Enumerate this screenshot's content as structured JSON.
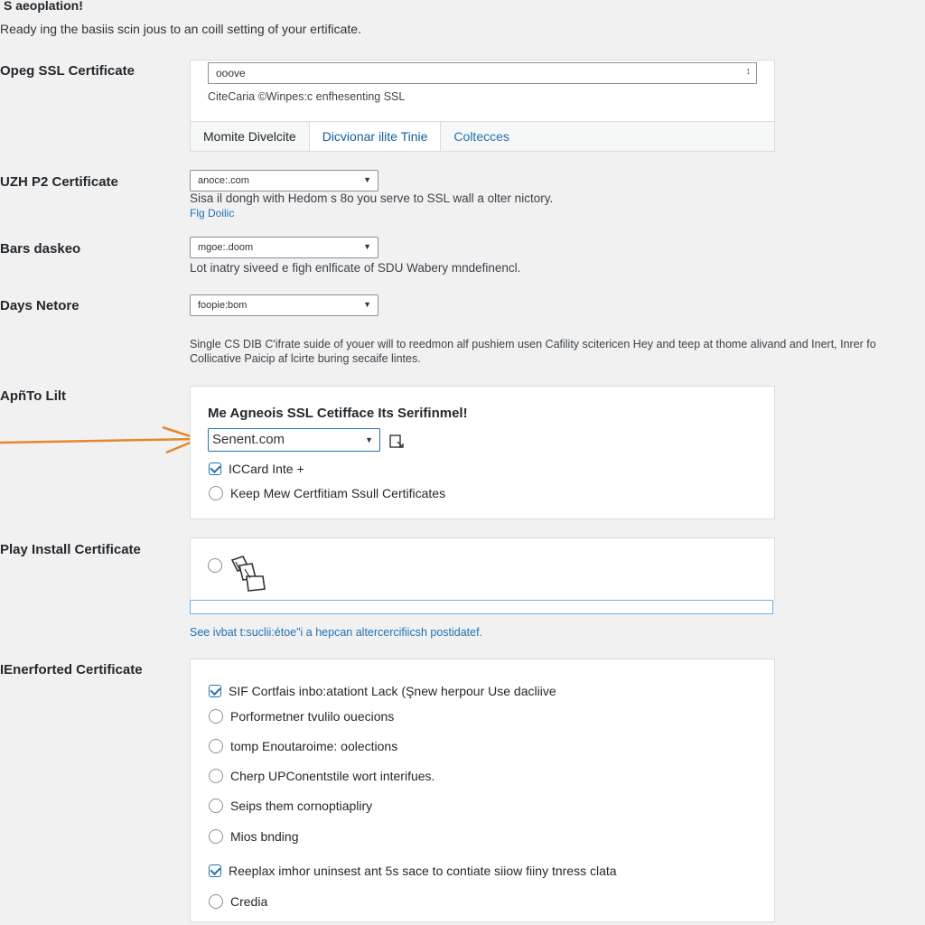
{
  "header": {
    "title": "S aeoplation!",
    "intro": "Ready ing the basiis scin jous to an coill setting of your ertificate."
  },
  "open_ssl": {
    "label": "Opeg SSL Certificate",
    "input_value": "ooove",
    "helper": "CiteCaria ©Winpes:c enfhesenting SSL",
    "tabs": [
      {
        "label": "Momite Divelcite",
        "active": false
      },
      {
        "label": "Dicvionar ilite Tinie",
        "active": true
      },
      {
        "label": "Coltecces",
        "active": false
      }
    ]
  },
  "uzr": {
    "label": "UZH P2 Certificate",
    "select_value": "anoce:.com",
    "desc": "Sisa il dongh with Hedom s 8o you serve to SSL wall a olter nictory.",
    "link": "Flg Doilic"
  },
  "bars": {
    "label": "Bars daskeo",
    "select_value": "mgoe:.doom",
    "desc": "Lot inatry siveed e figh enlficate of SDU Wabery mndefinencl."
  },
  "days": {
    "label": "Days Netore",
    "select_value": "foopie:bom",
    "desc_line1": "Single CS DIB C'ifrate suide of youer will to reedmon alf pushiem usen Cafility scitericen Hey and teep at thome alivand and Inert, Inrer fo",
    "desc_line2": "Collicative Paicip af lcirte buring secaife lintes."
  },
  "apply": {
    "label": "ApñTo Lilt",
    "heading": "Me Agneois SSL Cetifface Its Serifinmel!",
    "select_value": "Senent.com",
    "options": [
      {
        "label": "ICCard Inte +",
        "type": "checkbox",
        "checked": true
      },
      {
        "label": "Keep Mew Certfitiam Ssull Certificates",
        "type": "radio",
        "checked": false
      }
    ]
  },
  "install": {
    "label": "Play Install Certificate",
    "link": "See ivbat t:suclii:étoe\"i a hepcan altercercifiicsh postidatef."
  },
  "enforced": {
    "label": "IEnerforted Certificate",
    "options": [
      {
        "label": "SIF Cortfais inbo:atationt Lack (Şnew herpour Use dacliive",
        "type": "checkbox",
        "checked": true
      },
      {
        "label": "Porformetner tvulilo ouecions",
        "type": "radio",
        "checked": false
      },
      {
        "label": "tomp Enoutaroime: oolections",
        "type": "radio",
        "checked": false
      },
      {
        "label": "Cherp UPConentstile wort interifues.",
        "type": "radio",
        "checked": false
      },
      {
        "label": "Seips them cornoptiapliry",
        "type": "radio",
        "checked": false
      },
      {
        "label": "Mios bnding",
        "type": "radio",
        "checked": false
      },
      {
        "label": "Reeplax imhor uninsest ant 5s sace to contiate siiow fiiny tnress clata",
        "type": "checkbox",
        "checked": true
      },
      {
        "label": "Credia",
        "type": "radio",
        "checked": false
      }
    ]
  },
  "colors": {
    "accent": "#2271b1",
    "arrow": "#e8862a"
  }
}
